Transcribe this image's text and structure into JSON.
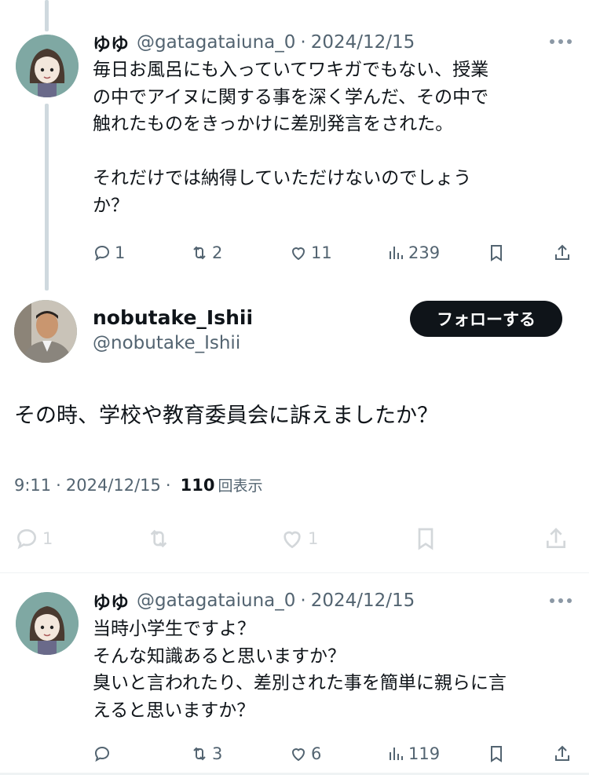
{
  "tweet1": {
    "name": "ゆゆ",
    "handle": "@gatagataiuna_0",
    "separator": "·",
    "date": "2024/12/15",
    "lines": [
      "毎日お風呂にも入っていてワキガでもない、授業",
      "の中でアイヌに関する事を深く学んだ、その中で",
      "触れたものをきっかけに差別発言をされた。",
      "",
      "それだけでは納得していただけないのでしょう",
      "か？"
    ],
    "replies": "1",
    "retweets": "2",
    "likes": "11",
    "views": "239"
  },
  "main_tweet": {
    "name": "nobutake_Ishii",
    "handle": "@nobutake_Ishii",
    "follow_label": "フォローする",
    "text": "その時、学校や教育委員会に訴えましたか？",
    "time": "9:11",
    "separator": "·",
    "date": "2024/12/15",
    "views": "110",
    "views_label": "回表示",
    "replies": "1",
    "likes": "1"
  },
  "tweet3": {
    "name": "ゆゆ",
    "handle": "@gatagataiuna_0",
    "separator": "·",
    "date": "2024/12/15",
    "lines": [
      "当時小学生ですよ？",
      "そんな知識あると思いますか？",
      "臭いと言われたり、差別された事を簡単に親らに言",
      "えると思いますか？"
    ],
    "retweets": "3",
    "likes": "6",
    "views": "119"
  },
  "icons": {
    "reply": "reply-icon",
    "retweet": "retweet-icon",
    "like": "heart-icon",
    "views": "views-chart-icon",
    "bookmark": "bookmark-icon",
    "share": "share-icon",
    "more": "more-dots-icon"
  },
  "colors": {
    "text": "#0f1419",
    "secondary": "#536471",
    "thread_line": "#cfd9de",
    "avatar_bg": "#7fa8a3",
    "follow_bg": "#0f1419"
  }
}
